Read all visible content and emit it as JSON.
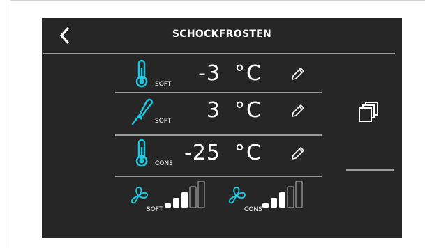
{
  "title": "SCHOCKFROSTEN",
  "colors": {
    "accent": "#1ec8e0",
    "screen_bg": "#262626",
    "text": "#ffffff",
    "rule": "#9a9a9a",
    "bar_inactive": "#9a9a9a",
    "bar_active": "#ffffff"
  },
  "rows": [
    {
      "icon": "thermometer-icon",
      "sub": "SOFT",
      "value": "-3",
      "unit": "°C",
      "edit_icon": "pencil-icon"
    },
    {
      "icon": "probe-icon",
      "sub": "SOFT",
      "value": "3",
      "unit": "°C",
      "edit_icon": "pencil-icon"
    },
    {
      "icon": "thermometer-icon",
      "sub": "CONS",
      "value": "-25",
      "unit": "°C",
      "edit_icon": "pencil-icon"
    }
  ],
  "fans": [
    {
      "icon": "fan-icon",
      "sub": "SOFT",
      "level": 3,
      "max": 5
    },
    {
      "icon": "fan-icon",
      "sub": "CONS",
      "level": 3,
      "max": 5
    }
  ],
  "side": {
    "copy_icon": "copy-icon"
  },
  "back_icon": "chevron-left-icon"
}
